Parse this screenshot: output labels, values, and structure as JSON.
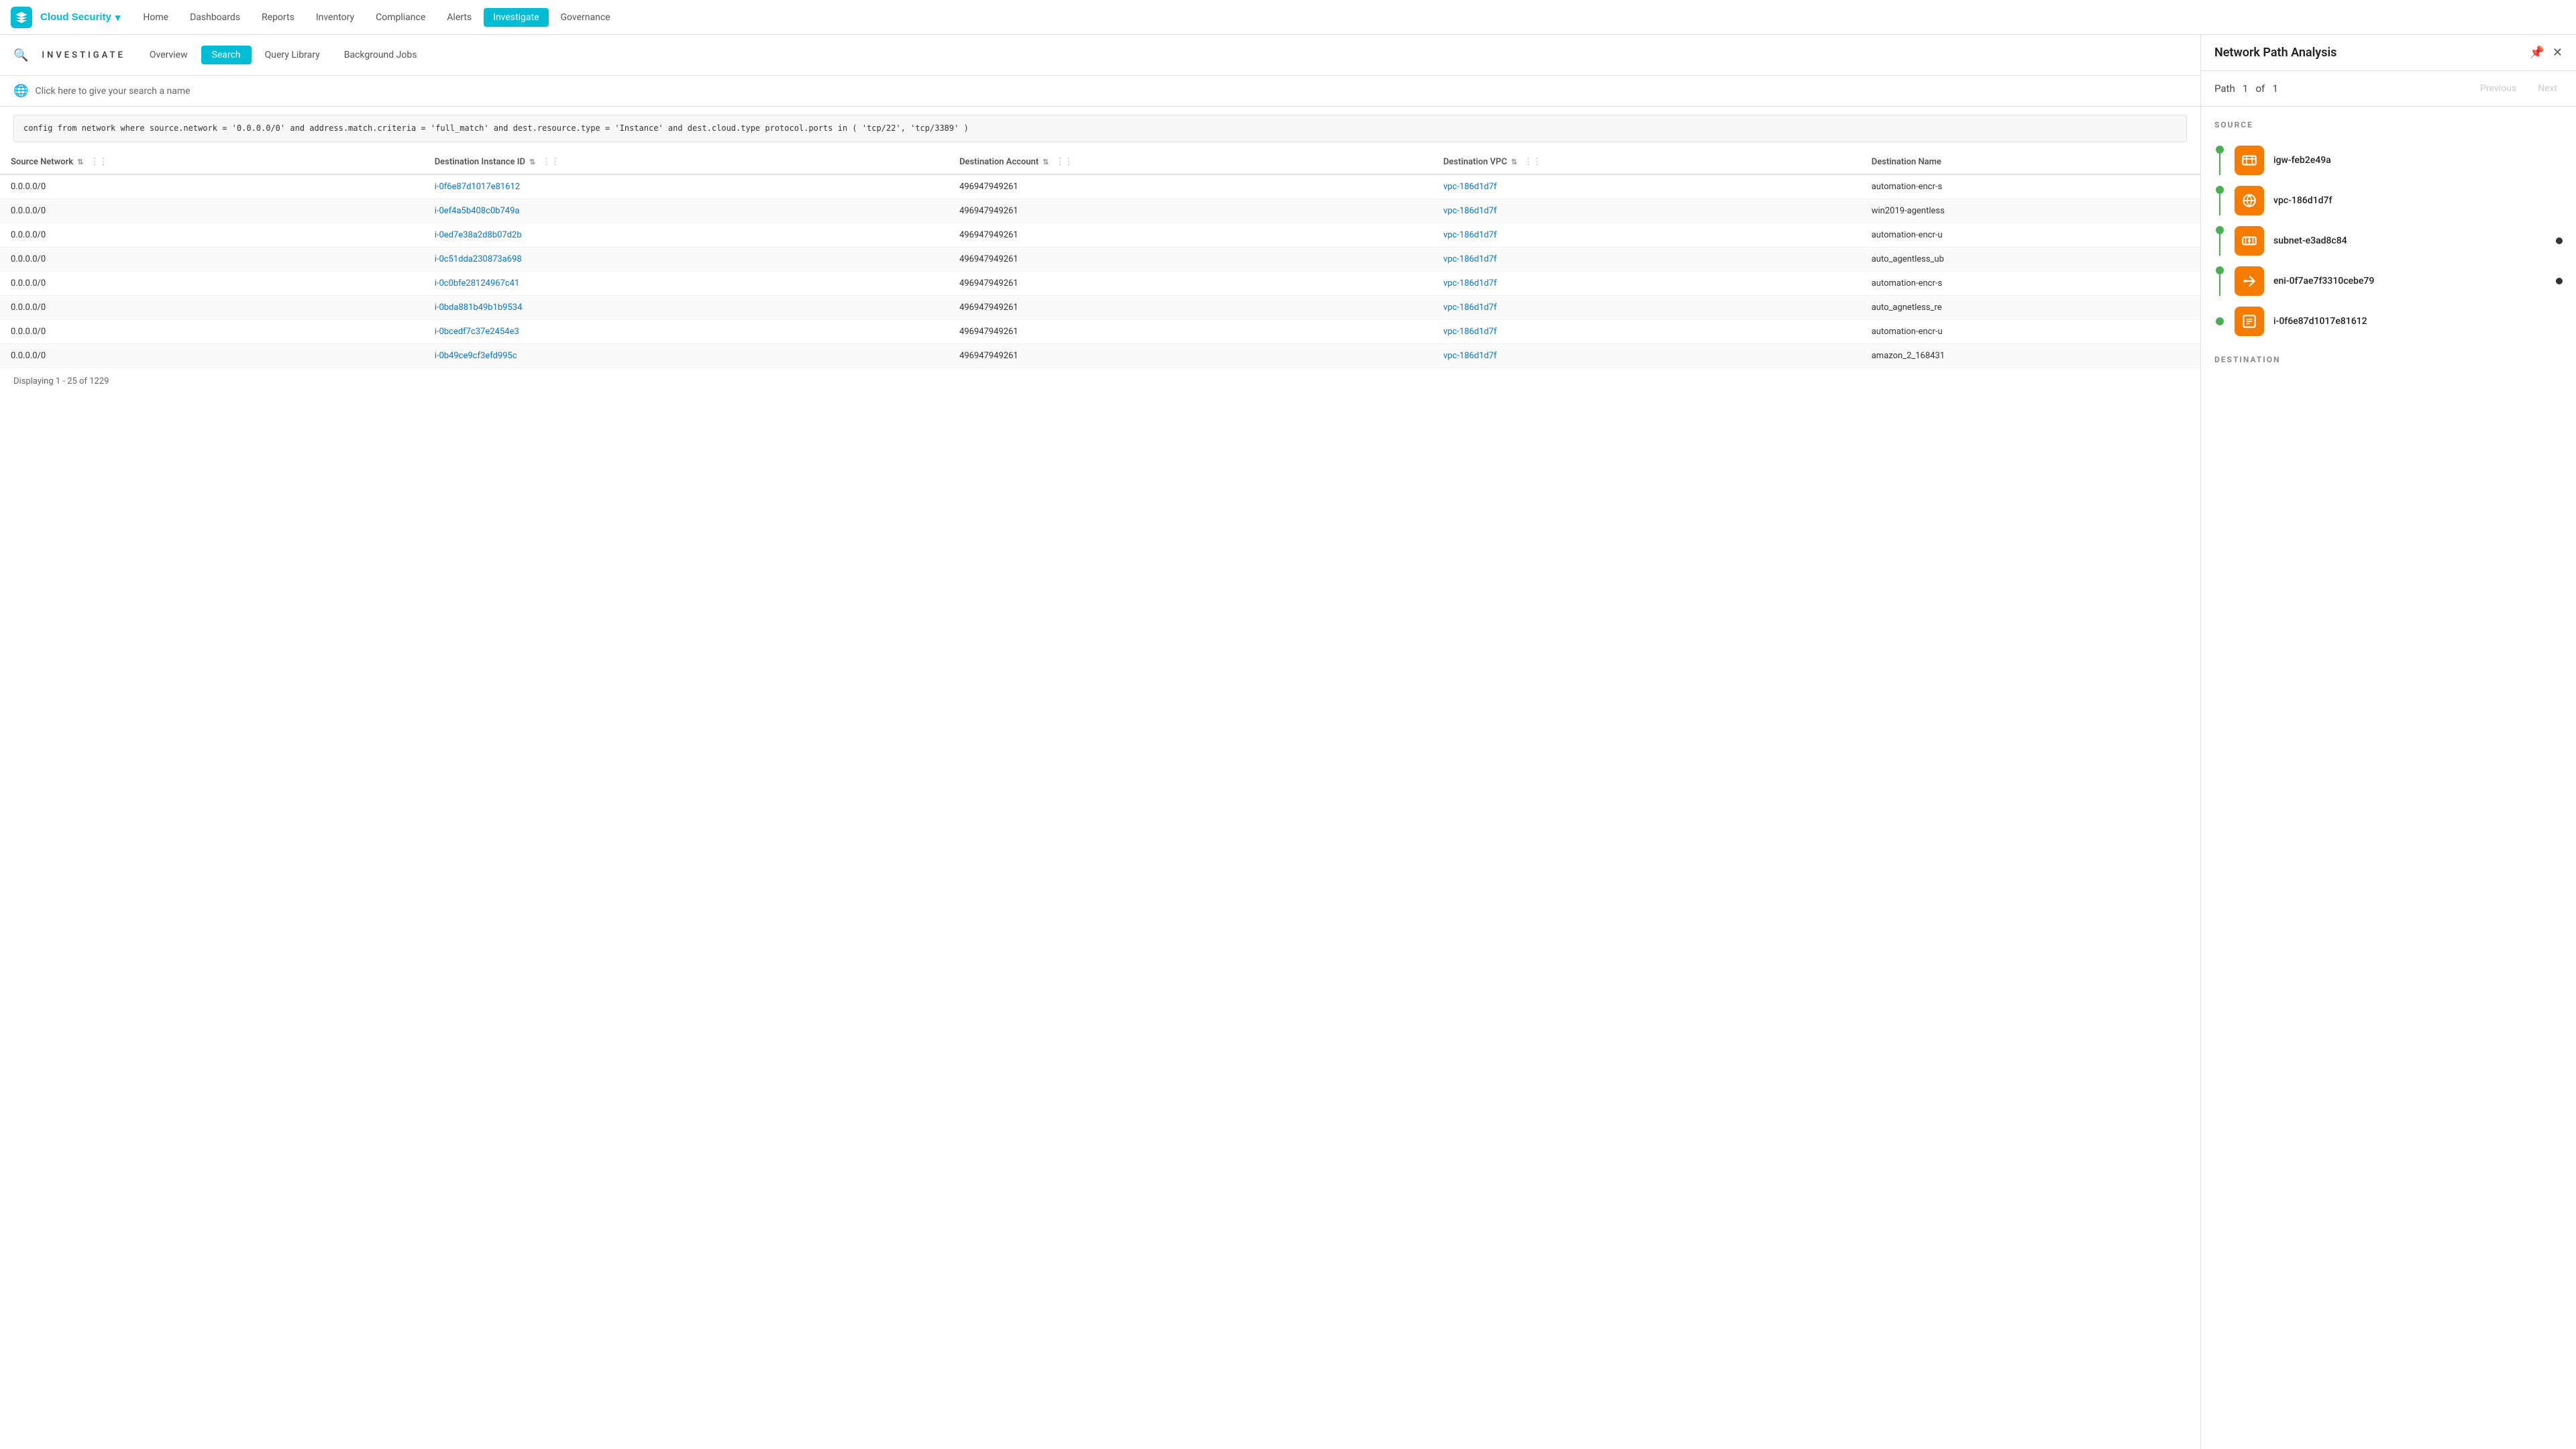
{
  "app": {
    "logo_text": "▲",
    "cloud_security_label": "Cloud Security",
    "nav_links": [
      {
        "id": "home",
        "label": "Home",
        "active": false
      },
      {
        "id": "dashboards",
        "label": "Dashboards",
        "active": false
      },
      {
        "id": "reports",
        "label": "Reports",
        "active": false
      },
      {
        "id": "inventory",
        "label": "Inventory",
        "active": false
      },
      {
        "id": "compliance",
        "label": "Compliance",
        "active": false
      },
      {
        "id": "alerts",
        "label": "Alerts",
        "active": false
      },
      {
        "id": "investigate",
        "label": "Investigate",
        "active": true
      },
      {
        "id": "governance",
        "label": "Governance",
        "active": false
      }
    ]
  },
  "investigate": {
    "title": "INVESTIGATE",
    "tabs": [
      {
        "id": "overview",
        "label": "Overview",
        "active": false
      },
      {
        "id": "search",
        "label": "Search",
        "active": true
      },
      {
        "id": "query-library",
        "label": "Query Library",
        "active": false
      },
      {
        "id": "background-jobs",
        "label": "Background Jobs",
        "active": false
      }
    ]
  },
  "search_name": {
    "placeholder": "Click here to give your search a name",
    "globe": "🌐"
  },
  "query": "config from network where source.network = '0.0.0.0/0' and address.match.criteria = 'full_match' and dest.resource.type = 'Instance' and dest.cloud.type\nprotocol.ports in ( 'tcp/22', 'tcp/3389' )",
  "table": {
    "columns": [
      {
        "id": "source-network",
        "label": "Source Network"
      },
      {
        "id": "destination-instance-id",
        "label": "Destination Instance ID"
      },
      {
        "id": "destination-account",
        "label": "Destination Account"
      },
      {
        "id": "destination-vpc",
        "label": "Destination VPC"
      },
      {
        "id": "destination-name",
        "label": "Destination Name"
      }
    ],
    "rows": [
      {
        "source": "0.0.0.0/0",
        "dest_id": "i-0f6e87d1017e81612",
        "account": "496947949261",
        "vpc": "vpc-186d1d7f",
        "name": "automation-encr-s"
      },
      {
        "source": "0.0.0.0/0",
        "dest_id": "i-0ef4a5b408c0b749a",
        "account": "496947949261",
        "vpc": "vpc-186d1d7f",
        "name": "win2019-agentless"
      },
      {
        "source": "0.0.0.0/0",
        "dest_id": "i-0ed7e38a2d8b07d2b",
        "account": "496947949261",
        "vpc": "vpc-186d1d7f",
        "name": "automation-encr-u"
      },
      {
        "source": "0.0.0.0/0",
        "dest_id": "i-0c51dda230873a698",
        "account": "496947949261",
        "vpc": "vpc-186d1d7f",
        "name": "auto_agentless_ub"
      },
      {
        "source": "0.0.0.0/0",
        "dest_id": "i-0c0bfe28124967c41",
        "account": "496947949261",
        "vpc": "vpc-186d1d7f",
        "name": "automation-encr-s"
      },
      {
        "source": "0.0.0.0/0",
        "dest_id": "i-0bda881b49b1b9534",
        "account": "496947949261",
        "vpc": "vpc-186d1d7f",
        "name": "auto_agnetless_re"
      },
      {
        "source": "0.0.0.0/0",
        "dest_id": "i-0bcedf7c37e2454e3",
        "account": "496947949261",
        "vpc": "vpc-186d1d7f",
        "name": "automation-encr-u"
      },
      {
        "source": "0.0.0.0/0",
        "dest_id": "i-0b49ce9cf3efd995c",
        "account": "496947949261",
        "vpc": "vpc-186d1d7f",
        "name": "amazon_2_168431"
      }
    ],
    "footer": "Displaying 1 - 25 of 1229"
  },
  "right_panel": {
    "title": "Network Path Analysis",
    "path_label": "Path",
    "path_current": "1",
    "path_of": "of",
    "path_total": "1",
    "previous_label": "Previous",
    "next_label": "Next",
    "source_section": "SOURCE",
    "destination_section": "DESTINATION",
    "nodes": [
      {
        "id": "igw",
        "label": "igw-feb2e49a",
        "has_dot": false,
        "icon_type": "gateway"
      },
      {
        "id": "vpc",
        "label": "vpc-186d1d7f",
        "has_dot": false,
        "icon_type": "vpc"
      },
      {
        "id": "subnet",
        "label": "subnet-e3ad8c84",
        "has_dot": true,
        "icon_type": "subnet"
      },
      {
        "id": "eni",
        "label": "eni-0f7ae7f3310cebe79",
        "has_dot": true,
        "icon_type": "eni"
      },
      {
        "id": "instance",
        "label": "i-0f6e87d1017e81612",
        "has_dot": false,
        "icon_type": "instance"
      }
    ]
  }
}
